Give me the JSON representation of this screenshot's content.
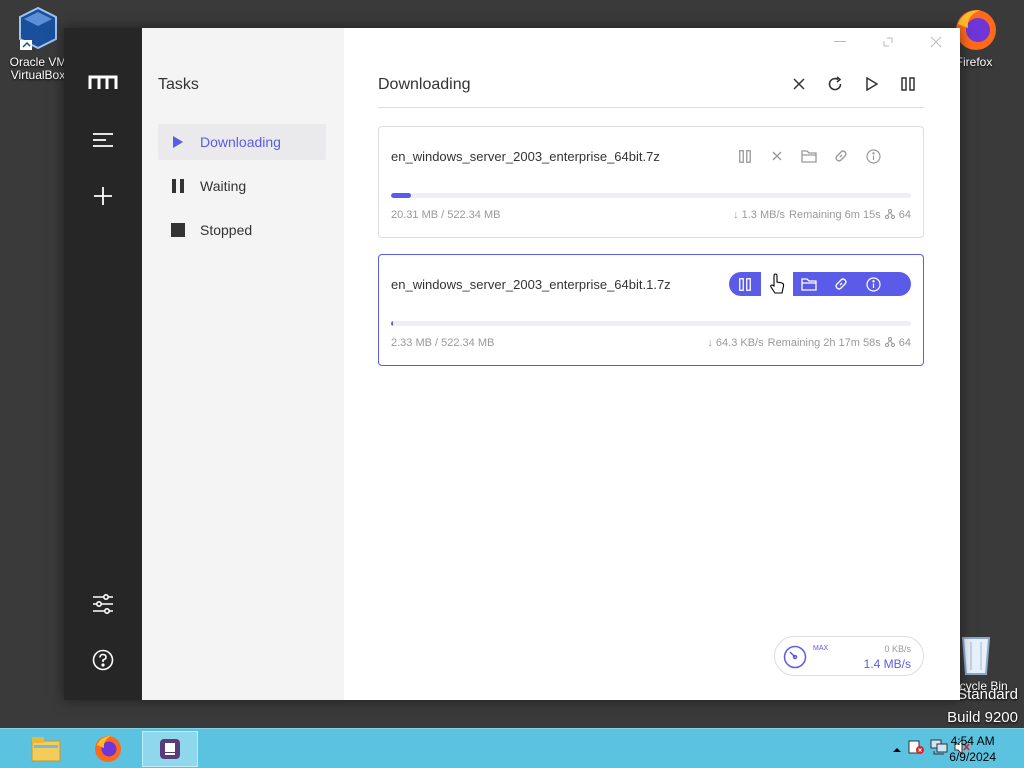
{
  "desktop": {
    "vbox_label": "Oracle VM VirtualBox",
    "firefox_label": "Firefox",
    "recycle_label": "Recycle Bin",
    "watermark_line1": "Standard",
    "watermark_line2": "Build 9200"
  },
  "sidebar": {
    "title": "Tasks"
  },
  "nav": [
    {
      "label": "Downloading",
      "icon": "play-icon",
      "active": true
    },
    {
      "label": "Waiting",
      "icon": "pause-icon"
    },
    {
      "label": "Stopped",
      "icon": "stop-icon"
    }
  ],
  "main": {
    "title": "Downloading"
  },
  "tasks": [
    {
      "name": "en_windows_server_2003_enterprise_64bit.7z",
      "progress": 0.039,
      "size": "20.31 MB / 522.34 MB",
      "speed": "↓ 1.3 MB/s",
      "remaining": "Remaining 6m 15s",
      "connections": "64"
    },
    {
      "name": "en_windows_server_2003_enterprise_64bit.1.7z",
      "progress": 0.0045,
      "size": "2.33 MB / 522.34 MB",
      "speed": "↓ 64.3 KB/s",
      "remaining": "Remaining 2h 17m 58s",
      "connections": "64"
    }
  ],
  "speedometer": {
    "max_label": "MAX",
    "upload": "0 KB/s",
    "download": "1.4 MB/s"
  },
  "taskbar": {
    "time": "4:54 AM",
    "date": "6/9/2024"
  },
  "colors": {
    "accent": "#5b5bea",
    "rail": "#262626",
    "taskbar": "#5bc3e0"
  }
}
